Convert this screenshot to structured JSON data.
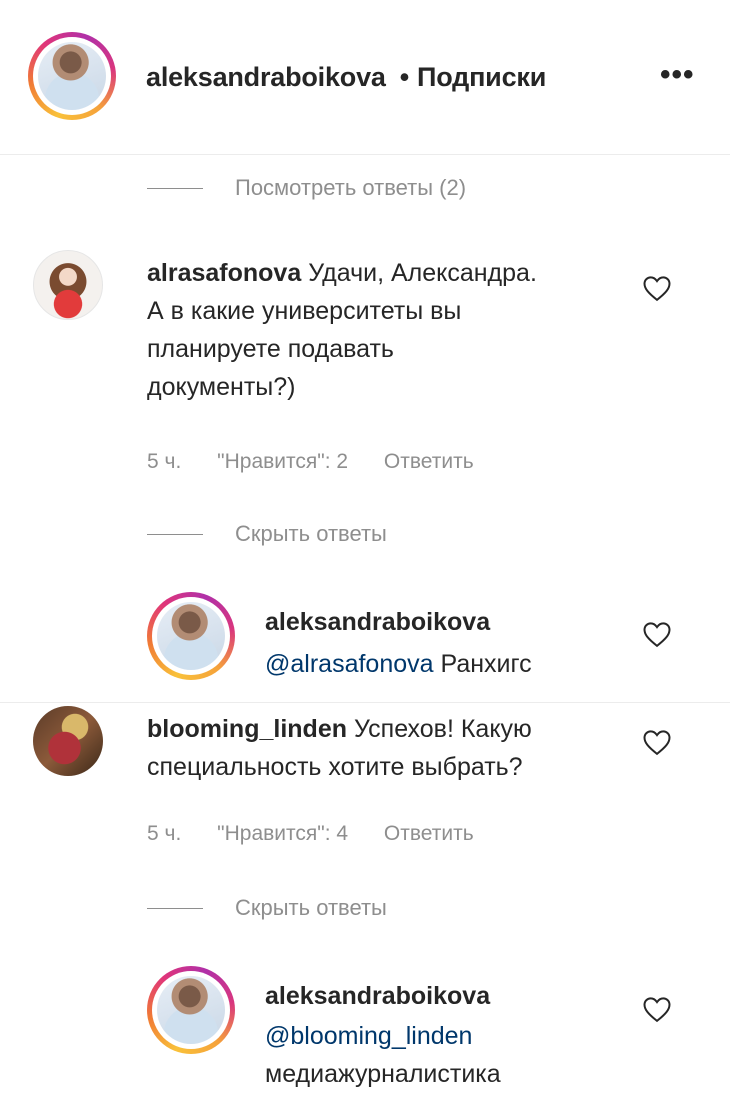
{
  "header": {
    "username": "aleksandraboikova",
    "separator": "•",
    "follow_label": "Подписки",
    "more_icon": "•••"
  },
  "thread": {
    "view_replies_label": "Посмотреть ответы (2)",
    "comments": [
      {
        "username": "alrasafonova",
        "text_lines": [
          "Удачи, Александра.",
          "А в какие университеты вы",
          "планируете подавать",
          "документы?)"
        ],
        "time": "5 ч.",
        "likes": "\"Нравится\": 2",
        "reply_label": "Ответить",
        "toggle_label": "Скрыть ответы",
        "reply": {
          "username": "aleksandraboikova",
          "mention": "@alrasafonova",
          "text": "Ранхигс"
        }
      },
      {
        "username": "blooming_linden",
        "text_first": "Успехов! Какую",
        "text_second": "специальность хотите выбрать?",
        "time": "5 ч.",
        "likes": "\"Нравится\": 4",
        "reply_label": "Ответить",
        "toggle_label": "Скрыть ответы",
        "reply": {
          "username": "aleksandraboikova",
          "mention": "@blooming_linden",
          "text": "медиажурналистика"
        }
      }
    ]
  },
  "colors": {
    "text": "#262626",
    "secondary": "#8e8e8e",
    "mention": "#00376b"
  }
}
